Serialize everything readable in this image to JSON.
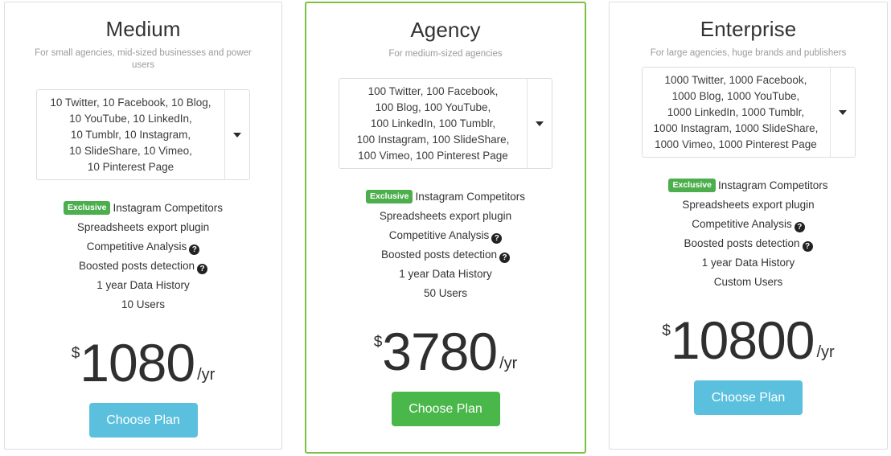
{
  "plans": [
    {
      "title": "Medium",
      "subtitle": "For small agencies, mid-sized businesses and power users",
      "quota_text": "10 Twitter, 10 Facebook, 10 Blog,\n10 YouTube, 10 LinkedIn,\n10 Tumblr, 10 Instagram,\n10 SlideShare, 10 Vimeo,\n10 Pinterest Page",
      "quota_caret_icon": "chevron-down-icon",
      "features": [
        {
          "badge": "Exclusive",
          "label": "Instagram Competitors",
          "help": false
        },
        {
          "badge": null,
          "label": "Spreadsheets export plugin",
          "help": false
        },
        {
          "badge": null,
          "label": "Competitive Analysis",
          "help": true
        },
        {
          "badge": null,
          "label": "Boosted posts detection",
          "help": true
        },
        {
          "badge": null,
          "label": "1 year Data History",
          "help": false
        },
        {
          "badge": null,
          "label": "10 Users",
          "help": false
        }
      ],
      "currency": "$",
      "price": "1080",
      "period": "/yr",
      "button_label": "Choose Plan",
      "button_color": "#5bc0de",
      "featured": false
    },
    {
      "title": "Agency",
      "subtitle": "For medium-sized agencies",
      "quota_text": "100 Twitter, 100 Facebook,\n100 Blog, 100 YouTube,\n100 LinkedIn, 100 Tumblr,\n100 Instagram, 100 SlideShare,\n100 Vimeo, 100 Pinterest Page",
      "quota_caret_icon": "chevron-down-icon",
      "features": [
        {
          "badge": "Exclusive",
          "label": "Instagram Competitors",
          "help": false
        },
        {
          "badge": null,
          "label": "Spreadsheets export plugin",
          "help": false
        },
        {
          "badge": null,
          "label": "Competitive Analysis",
          "help": true
        },
        {
          "badge": null,
          "label": "Boosted posts detection",
          "help": true
        },
        {
          "badge": null,
          "label": "1 year Data History",
          "help": false
        },
        {
          "badge": null,
          "label": "50 Users",
          "help": false
        }
      ],
      "currency": "$",
      "price": "3780",
      "period": "/yr",
      "button_label": "Choose Plan",
      "button_color": "#49b749",
      "featured": true,
      "highlight_border_color": "#7ac143"
    },
    {
      "title": "Enterprise",
      "subtitle": "For large agencies, huge brands and publishers",
      "quota_text": "1000 Twitter, 1000 Facebook,\n1000 Blog, 1000 YouTube,\n1000 LinkedIn, 1000 Tumblr,\n1000 Instagram, 1000 SlideShare,\n1000 Vimeo, 1000 Pinterest Page",
      "quota_caret_icon": "chevron-down-icon",
      "features": [
        {
          "badge": "Exclusive",
          "label": "Instagram Competitors",
          "help": false
        },
        {
          "badge": null,
          "label": "Spreadsheets export plugin",
          "help": false
        },
        {
          "badge": null,
          "label": "Competitive Analysis",
          "help": true
        },
        {
          "badge": null,
          "label": "Boosted posts detection",
          "help": true
        },
        {
          "badge": null,
          "label": "1 year Data History",
          "help": false
        },
        {
          "badge": null,
          "label": "Custom Users",
          "help": false
        }
      ],
      "currency": "$",
      "price": "10800",
      "period": "/yr",
      "button_label": "Choose Plan",
      "button_color": "#5bc0de",
      "featured": false
    }
  ],
  "help_glyph": "?",
  "badge_color": "#4cae4c"
}
